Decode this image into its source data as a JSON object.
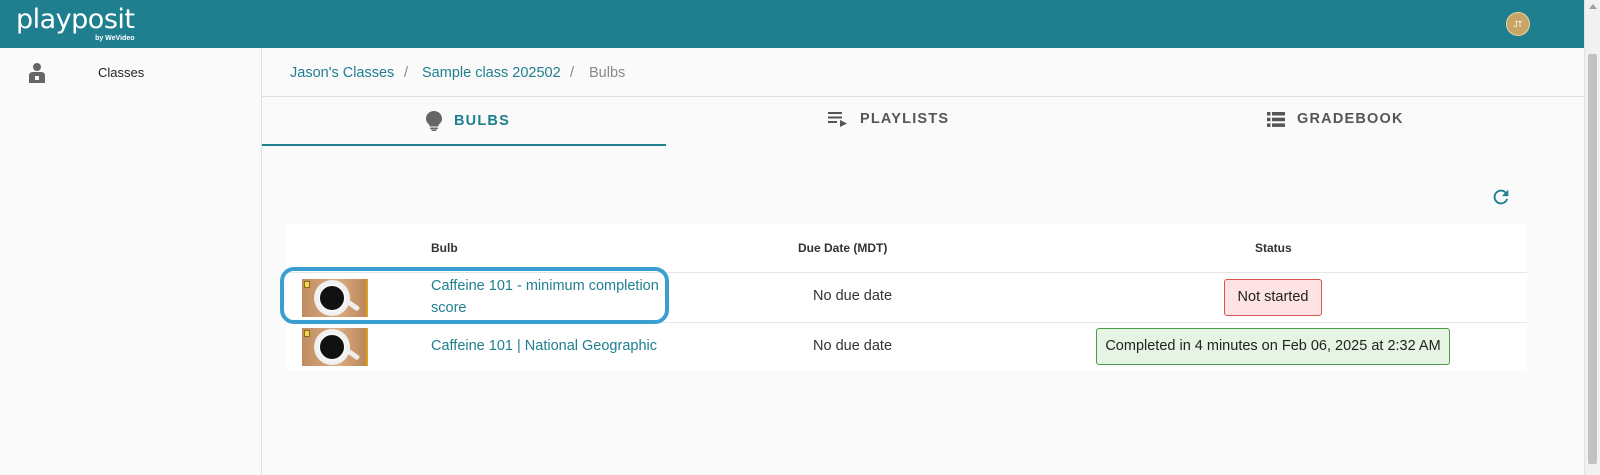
{
  "app": {
    "logo_text": "playposit",
    "logo_sub": "by WeVideo",
    "avatar_initials": "JT",
    "brand_color": "#1f7f8f"
  },
  "sidebar": {
    "items": [
      {
        "label": "Classes",
        "icon": "person-badge-icon"
      }
    ]
  },
  "breadcrumb": {
    "items": [
      {
        "label": "Jason's Classes"
      },
      {
        "label": "Sample class 202502"
      },
      {
        "label": "Bulbs"
      }
    ],
    "separator": "/"
  },
  "tabs": [
    {
      "label": "Bulbs",
      "icon": "lightbulb-icon",
      "active": true
    },
    {
      "label": "Playlists",
      "icon": "playlist-icon",
      "active": false
    },
    {
      "label": "Gradebook",
      "icon": "list-icon",
      "active": false
    }
  ],
  "table": {
    "headers": {
      "bulb": "Bulb",
      "due": "Due Date (MDT)",
      "status": "Status"
    },
    "rows": [
      {
        "title_line1": "Caffeine 101 - minimum completion",
        "title_line2": "score",
        "due": "No due date",
        "status": "Not started",
        "status_color": "#d9534f"
      },
      {
        "title_line1": "Caffeine 101 | National Geographic",
        "due": "No due date",
        "status": "Completed in 4 minutes on Feb 06, 2025 at 2:32 AM",
        "status_color": "#4c9a4c"
      }
    ]
  }
}
